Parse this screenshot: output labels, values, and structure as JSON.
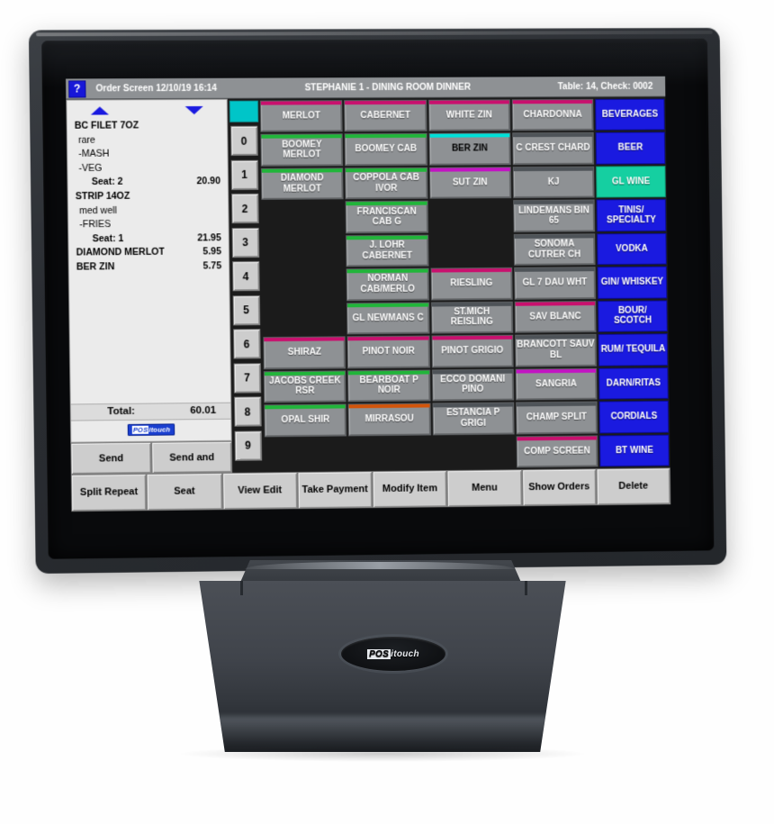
{
  "titlebar": {
    "help_label": "?",
    "left": "Order Screen 12/10/19 16:14",
    "center": "STEPHANIE 1 - DINING ROOM DINNER",
    "right": "Table:  14, Check: 0002"
  },
  "ticket": {
    "scroll_up_icon": "triangle-up",
    "scroll_down_icon": "triangle-down",
    "lines": [
      {
        "name": "BC FILET 7OZ",
        "price": "",
        "indent": 0,
        "bold": true
      },
      {
        "name": "rare",
        "price": "",
        "indent": 1,
        "bold": false
      },
      {
        "name": "-MASH",
        "price": "",
        "indent": 1,
        "bold": false
      },
      {
        "name": "-VEG",
        "price": "",
        "indent": 1,
        "bold": false
      },
      {
        "name": "Seat:    2",
        "price": "20.90",
        "indent": 2,
        "bold": true
      },
      {
        "name": "STRIP 14OZ",
        "price": "",
        "indent": 0,
        "bold": true
      },
      {
        "name": "med well",
        "price": "",
        "indent": 1,
        "bold": false
      },
      {
        "name": "-FRIES",
        "price": "",
        "indent": 1,
        "bold": false
      },
      {
        "name": "Seat:    1",
        "price": "21.95",
        "indent": 2,
        "bold": true
      },
      {
        "name": "DIAMOND MERLOT",
        "price": "5.95",
        "indent": 0,
        "bold": true
      },
      {
        "name": "BER ZIN",
        "price": "5.75",
        "indent": 0,
        "bold": true
      }
    ],
    "total_label": "Total:",
    "total_value": "60.01",
    "brand": {
      "part1": "POS",
      "part2": "itouch"
    }
  },
  "send_buttons": [
    {
      "label": "Send"
    },
    {
      "label": "Send and"
    }
  ],
  "numpad": {
    "top_swatch_color": "#00c5c8",
    "digits": [
      "0",
      "1",
      "2",
      "3",
      "4",
      "5",
      "6",
      "7",
      "8",
      "9"
    ]
  },
  "grid": {
    "rows": [
      [
        {
          "label": "MERLOT",
          "stripe": "#c9106e",
          "text": "light"
        },
        {
          "label": "CABERNET",
          "stripe": "#c9106e",
          "text": "light"
        },
        {
          "label": "WHITE ZIN",
          "stripe": "#c9106e",
          "text": "light"
        },
        {
          "label": "CHARDONNA",
          "stripe": "#c9106e",
          "text": "light"
        }
      ],
      [
        {
          "label": "BOOMEY MERLOT",
          "stripe": "#21b53a",
          "text": "light"
        },
        {
          "label": "BOOMEY CAB",
          "stripe": "#21b53a",
          "text": "light"
        },
        {
          "label": "BER ZIN",
          "stripe": "#00e0d8",
          "text": "dark"
        },
        {
          "label": "C CREST CHARD",
          "stripe": "#4e5358",
          "text": "light"
        }
      ],
      [
        {
          "label": "DIAMOND MERLOT",
          "stripe": "#21b53a",
          "text": "light"
        },
        {
          "label": "COPPOLA CAB IVOR",
          "stripe": "#21b53a",
          "text": "light"
        },
        {
          "label": "SUT ZIN",
          "stripe": "#c313c3",
          "text": "light"
        },
        {
          "label": "KJ",
          "stripe": "#4e5358",
          "text": "light"
        }
      ],
      [
        {
          "label": "",
          "stripe": "",
          "text": "empty"
        },
        {
          "label": "FRANCISCAN CAB G",
          "stripe": "#21b53a",
          "text": "light"
        },
        {
          "label": "",
          "stripe": "",
          "text": "empty"
        },
        {
          "label": "LINDEMANS BIN 65",
          "stripe": "#4e5358",
          "text": "light"
        }
      ],
      [
        {
          "label": "",
          "stripe": "",
          "text": "empty"
        },
        {
          "label": "J. LOHR CABERNET",
          "stripe": "#21b53a",
          "text": "light"
        },
        {
          "label": "",
          "stripe": "",
          "text": "empty"
        },
        {
          "label": "SONOMA CUTRER CH",
          "stripe": "#4e5358",
          "text": "light"
        }
      ],
      [
        {
          "label": "",
          "stripe": "",
          "text": "empty"
        },
        {
          "label": "NORMAN CAB/MERLO",
          "stripe": "#21b53a",
          "text": "light"
        },
        {
          "label": "RIESLING",
          "stripe": "#c9106e",
          "text": "light"
        },
        {
          "label": "GL 7 DAU WHT",
          "stripe": "#4e5358",
          "text": "light"
        }
      ],
      [
        {
          "label": "",
          "stripe": "",
          "text": "empty"
        },
        {
          "label": "GL NEWMANS C",
          "stripe": "#21b53a",
          "text": "light"
        },
        {
          "label": "ST.MICH REISLING",
          "stripe": "#4e5358",
          "text": "light"
        },
        {
          "label": "SAV BLANC",
          "stripe": "#c9106e",
          "text": "light"
        }
      ],
      [
        {
          "label": "SHIRAZ",
          "stripe": "#c9106e",
          "text": "light"
        },
        {
          "label": "PINOT NOIR",
          "stripe": "#c9106e",
          "text": "light"
        },
        {
          "label": "PINOT GRIGIO",
          "stripe": "#c9106e",
          "text": "light"
        },
        {
          "label": "BRANCOTT SAUV BL",
          "stripe": "#4e5358",
          "text": "light"
        }
      ],
      [
        {
          "label": "JACOBS CREEK RSR",
          "stripe": "#21b53a",
          "text": "light"
        },
        {
          "label": "BEARBOAT P NOIR",
          "stripe": "#21b53a",
          "text": "light"
        },
        {
          "label": "ECCO DOMANI PINO",
          "stripe": "#4e5358",
          "text": "light"
        },
        {
          "label": "SANGRIA",
          "stripe": "#c313c3",
          "text": "light"
        }
      ],
      [
        {
          "label": "OPAL SHIR",
          "stripe": "#21b53a",
          "text": "light"
        },
        {
          "label": "MIRRASOU",
          "stripe": "#d2540a",
          "text": "light"
        },
        {
          "label": "ESTANCIA P GRIGI",
          "stripe": "#4e5358",
          "text": "light"
        },
        {
          "label": "CHAMP SPLIT",
          "stripe": "#4e5358",
          "text": "light"
        }
      ],
      [
        {
          "label": "",
          "stripe": "",
          "text": "empty"
        },
        {
          "label": "",
          "stripe": "",
          "text": "empty"
        },
        {
          "label": "",
          "stripe": "",
          "text": "empty"
        },
        {
          "label": "COMP SCREEN",
          "stripe": "#c9106e",
          "text": "light"
        }
      ]
    ]
  },
  "categories": [
    {
      "label": "BEVERAGES",
      "active": false
    },
    {
      "label": "BEER",
      "active": false
    },
    {
      "label": "GL WINE",
      "active": true
    },
    {
      "label": "TINIS/ SPECIALTY",
      "active": false
    },
    {
      "label": "VODKA",
      "active": false
    },
    {
      "label": "GIN/ WHISKEY",
      "active": false
    },
    {
      "label": "BOUR/ SCOTCH",
      "active": false
    },
    {
      "label": "RUM/ TEQUILA",
      "active": false
    },
    {
      "label": "DARN/RITAS",
      "active": false
    },
    {
      "label": "CORDIALS",
      "active": false
    },
    {
      "label": "BT WINE",
      "active": false
    }
  ],
  "toolbar": [
    {
      "label": "Split Repeat"
    },
    {
      "label": "Seat"
    },
    {
      "label": "View Edit"
    },
    {
      "label": "Take Payment"
    },
    {
      "label": "Modify Item"
    },
    {
      "label": "Menu"
    },
    {
      "label": "Show Orders"
    },
    {
      "label": "Delete"
    }
  ],
  "hardware": {
    "base_logo": {
      "part1": "POS",
      "part2": "itouch"
    }
  },
  "colors": {
    "button_gray": "#8e9194",
    "category_blue": "#1a1ae0",
    "active_teal": "#15cfa1",
    "swatch_teal": "#00c5c8",
    "stripe_magenta": "#c9106e",
    "stripe_green": "#21b53a",
    "stripe_orange": "#d2540a",
    "stripe_purple": "#c313c3"
  }
}
